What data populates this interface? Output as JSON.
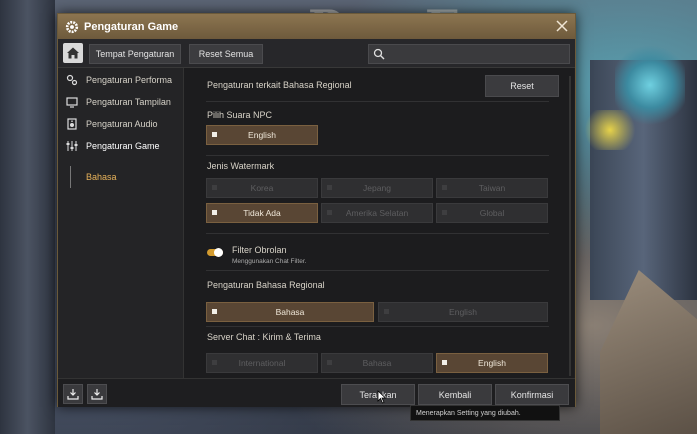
{
  "window": {
    "title": "Pengaturan Game"
  },
  "toolbar": {
    "tab_location": "Tempat Pengaturan",
    "reset_all": "Reset Semua",
    "search_placeholder": ""
  },
  "sidebar": {
    "items": [
      {
        "label": "Pengaturan Performa",
        "icon": "performance-icon"
      },
      {
        "label": "Pengaturan Tampilan",
        "icon": "monitor-icon"
      },
      {
        "label": "Pengaturan Audio",
        "icon": "speaker-icon"
      },
      {
        "label": "Pengaturan Game",
        "icon": "sliders-icon"
      }
    ],
    "sub_item": "Bahasa"
  },
  "content": {
    "section_title": "Pengaturan terkait Bahasa Regional",
    "reset_label": "Reset",
    "npc_voice": {
      "label": "Pilih Suara NPC",
      "options": [
        "English"
      ],
      "selected": "English"
    },
    "watermark": {
      "label": "Jenis Watermark",
      "options": [
        "Korea",
        "Jepang",
        "Taiwan",
        "Tidak Ada",
        "Amerika Selatan",
        "Global"
      ],
      "selected": "Tidak Ada"
    },
    "chat_filter": {
      "label": "Filter Obrolan",
      "sublabel": "Menggunakan Chat Filter.",
      "enabled": true
    },
    "regional_language": {
      "label": "Pengaturan Bahasa Regional",
      "options": [
        "Bahasa",
        "English"
      ],
      "selected": "Bahasa"
    },
    "server_chat": {
      "label": "Server Chat : Kirim & Terima",
      "options": [
        "International",
        "Bahasa",
        "English"
      ],
      "selected": "English"
    }
  },
  "footer": {
    "apply": "Terapkan",
    "back": "Kembali",
    "confirm": "Konfirmasi",
    "tooltip": "Menerapkan Setting yang diubah."
  },
  "colors": {
    "titlebar": "#8c7550",
    "accent": "#e7b25a",
    "selected_option": "#594634",
    "toggle_on": "#d39b2f"
  }
}
